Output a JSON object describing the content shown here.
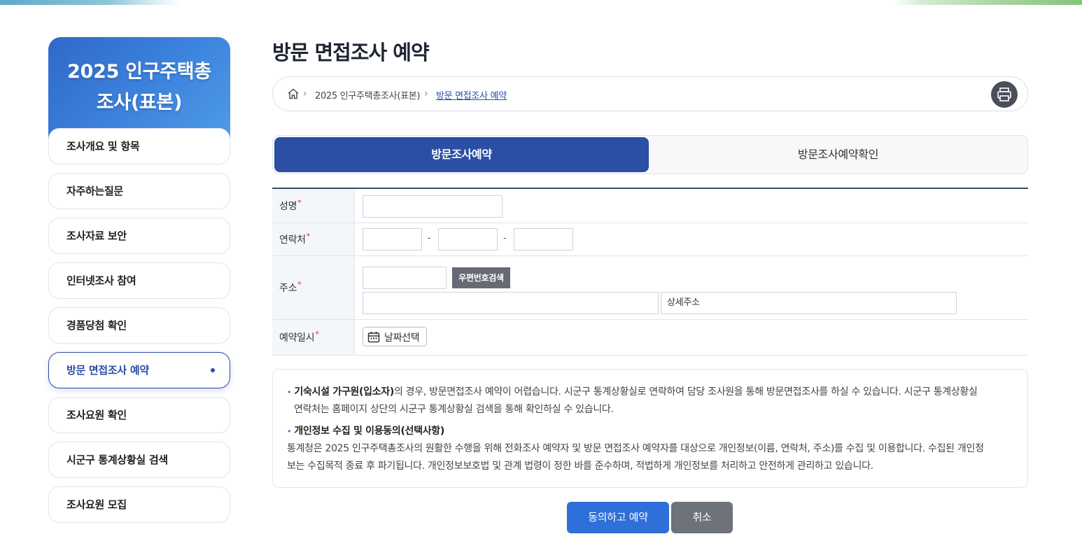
{
  "sidebar": {
    "title_line1": "2025 인구주택총",
    "title_line2": "조사(표본)",
    "items": [
      {
        "label": "조사개요 및 항목"
      },
      {
        "label": "자주하는질문"
      },
      {
        "label": "조사자료 보안"
      },
      {
        "label": "인터넷조사 참여"
      },
      {
        "label": "경품당첨 확인"
      },
      {
        "label": "방문 면접조사 예약",
        "active": true
      },
      {
        "label": "조사요원 확인"
      },
      {
        "label": "시군구 통계상황실 검색"
      },
      {
        "label": "조사요원 모집"
      }
    ]
  },
  "page": {
    "title": "방문 면접조사 예약"
  },
  "breadcrumb": {
    "items": [
      "2025 인구주택총조사(표본)",
      "방문 면접조사 예약"
    ],
    "home_icon": "home-icon",
    "print_icon": "printer-icon"
  },
  "tabs": [
    {
      "label": "방문조사예약",
      "active": true
    },
    {
      "label": "방문조사예약확인",
      "active": false
    }
  ],
  "form": {
    "required_mark": "*",
    "name_label": "성명",
    "phone_label": "연락처",
    "phone_separator": "-",
    "address_label": "주소",
    "zip_button": "우편번호검색",
    "detail_address_placeholder": "상세주소",
    "date_label": "예약일시",
    "date_button": "날짜선택",
    "date_icon": "calendar-icon"
  },
  "notice": {
    "item1_bold": "기숙시설 가구원(입소자)",
    "item1_text": "의 경우, 방문면접조사 예약이 어렵습니다. 시군구 통계상황실로 연락하여 담당 조사원을 통해 방문면접조사를 하실 수 있습니다. 시군구 통계상황실",
    "item1_text2": "연락처는 홈페이지 상단의 시군구 통계상황실 검색을 통해 확인하실 수 있습니다.",
    "item2_title": "개인정보 수집 및 이용동의(선택사항)",
    "item2_text1": "통계청은 2025 인구주택총조사의 원활한 수행을 위해 전화조사 예약자 및 방문 면접조사 예약자를 대상으로 개인정보(이름, 연락처, 주소)를 수집 및 이용합니다. 수집된 개인정",
    "item2_text2": "보는 수집목적 종료 후 파기됩니다. 개인정보보호법 및 관계 법령이 정한 바를 준수하며, 적법하게 개인정보를 처리하고 안전하게 관리하고 있습니다.",
    "bullet": "•"
  },
  "buttons": {
    "agree": "동의하고 예약",
    "cancel": "취소"
  },
  "colors": {
    "primary": "#2a4fa3",
    "accent_blue": "#2e6fd9",
    "required": "#d9382f",
    "gray_button": "#6e7279"
  }
}
